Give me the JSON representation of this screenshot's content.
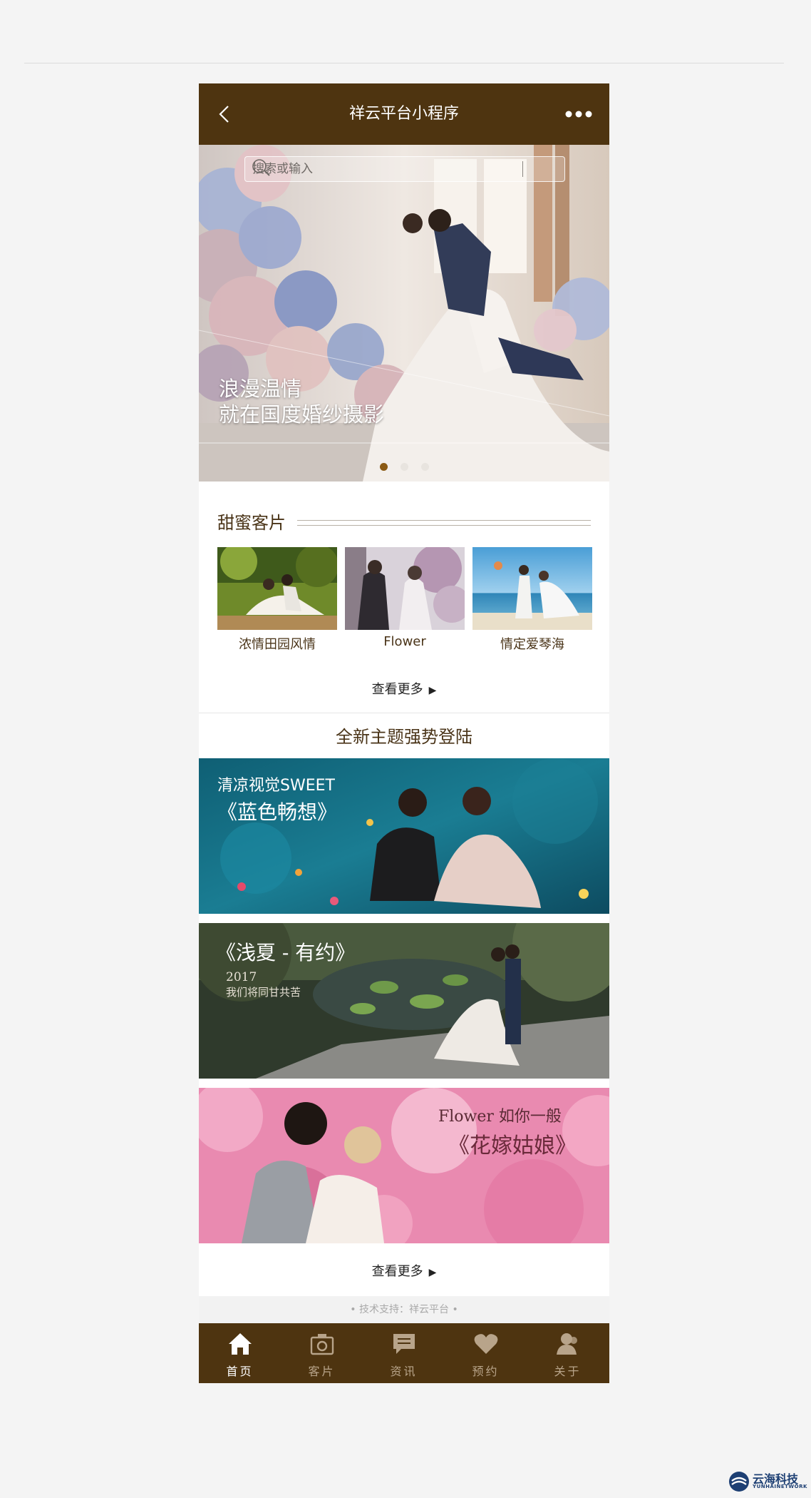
{
  "nav": {
    "title": "祥云平台小程序"
  },
  "search": {
    "placeholder": "搜索或输入"
  },
  "banner": {
    "caption_line1": "浪漫温情",
    "caption_line2": "就在国度婚纱摄影",
    "slides": 3,
    "active_slide": 1
  },
  "clients": {
    "title": "甜蜜客片",
    "items": [
      {
        "label": "浓情田园风情"
      },
      {
        "label": "Flower"
      },
      {
        "label": "情定爱琴海"
      }
    ],
    "more": "查看更多"
  },
  "themes": {
    "title": "全新主题强势登陆",
    "items": [
      {
        "line1": "清凉视觉SWEET",
        "line2": "《蓝色畅想》"
      },
      {
        "line1": "《浅夏 - 有约》",
        "line2": "2017",
        "line3": "我们将同甘共苦"
      },
      {
        "line1": "Flower 如你一般",
        "line2": "《花嫁姑娘》"
      }
    ],
    "more": "查看更多"
  },
  "footer": {
    "text": "•    技术支持：祥云平台    •"
  },
  "tabbar": [
    {
      "label": "首页",
      "icon": "home-icon",
      "active": true
    },
    {
      "label": "客片",
      "icon": "camera-icon",
      "active": false
    },
    {
      "label": "资讯",
      "icon": "chat-icon",
      "active": false
    },
    {
      "label": "预约",
      "icon": "heart-icon",
      "active": false
    },
    {
      "label": "关于",
      "icon": "user-icon",
      "active": false
    }
  ],
  "watermark": {
    "name": "云海科技",
    "en": "YUNHAINETWORK"
  },
  "colors": {
    "brand": "#4e3410",
    "accent": "#8b5a14",
    "title_text": "#4a3418"
  }
}
